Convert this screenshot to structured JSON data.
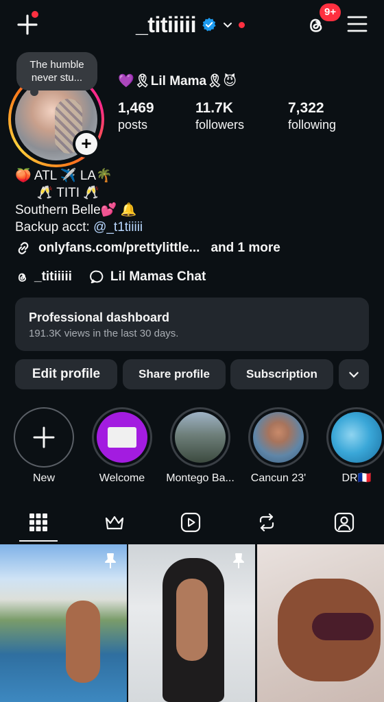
{
  "header": {
    "username": "_titiiiii",
    "badge_count": "9+",
    "icons": {
      "create": "plus-icon",
      "verified": "verified-badge-icon",
      "switch_account": "chevron-down-icon",
      "threads": "threads-icon",
      "menu": "hamburger-menu-icon"
    },
    "colors": {
      "notification": "#ff3040",
      "verified": "#1d9bf0"
    }
  },
  "profile": {
    "note": "The humble never stu...",
    "display_name": "💜🎗Lil Mama🎗😈",
    "stats": [
      {
        "value": "1,469",
        "label": "posts"
      },
      {
        "value": "11.7K",
        "label": "followers"
      },
      {
        "value": "7,322",
        "label": "following"
      }
    ],
    "bio_lines": [
      "🍑 ATL ✈️ LA🌴",
      "      🥂 TITI 🥂",
      "Southern Belle💕 🔔"
    ],
    "backup_prefix": "Backup acct: ",
    "backup_handle": "@_t1tiiiii",
    "link_text": "onlyfans.com/prettylittle...",
    "link_more": "and 1 more",
    "threads_handle": "_titiiiii",
    "chat_name": "Lil Mamas Chat"
  },
  "dashboard": {
    "title": "Professional dashboard",
    "subtitle": "191.3K views in the last 30 days."
  },
  "actions": {
    "edit": "Edit profile",
    "share": "Share profile",
    "subscription": "Subscription"
  },
  "highlights": [
    {
      "label": "New"
    },
    {
      "label": "Welcome"
    },
    {
      "label": "Montego Ba..."
    },
    {
      "label": "Cancun 23'"
    },
    {
      "label": "DR🇫🇷"
    }
  ],
  "tabs": [
    "grid-icon",
    "crown-icon",
    "reels-icon",
    "reposts-icon",
    "tagged-icon"
  ]
}
